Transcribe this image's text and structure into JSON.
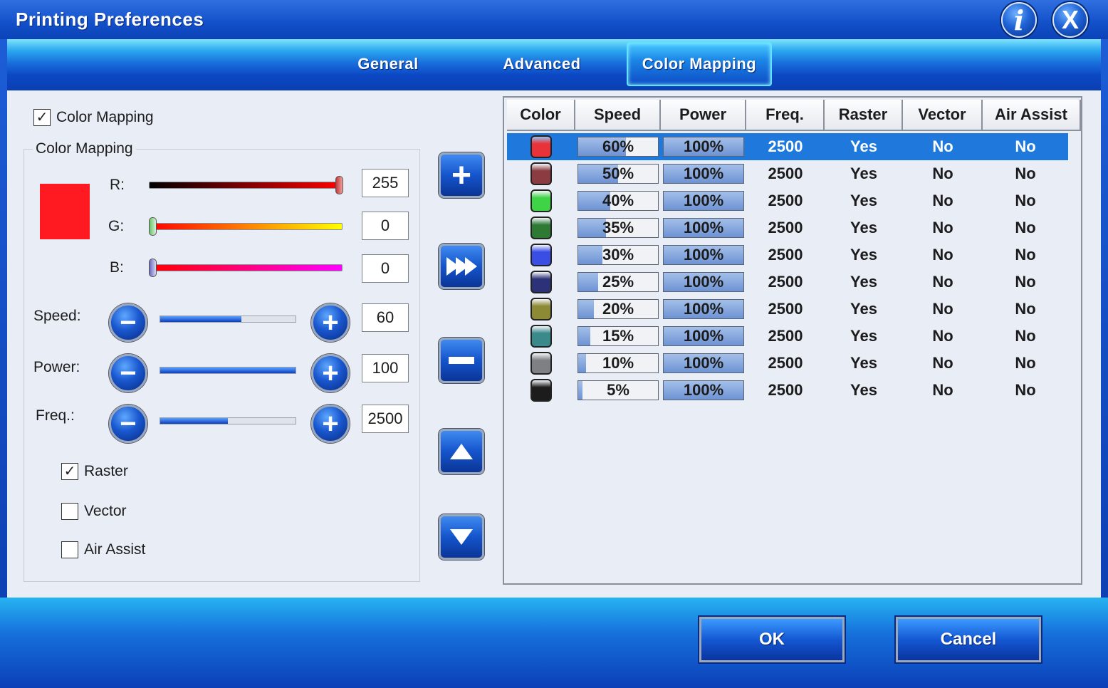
{
  "window": {
    "title": "Printing Preferences"
  },
  "title_buttons": {
    "info": "i",
    "close": "X"
  },
  "tabs": [
    {
      "label": "General"
    },
    {
      "label": "Advanced"
    },
    {
      "label": "Color Mapping",
      "active": true
    }
  ],
  "left": {
    "enable_checkbox": {
      "label": "Color Mapping",
      "checked": true
    },
    "group_title": "Color Mapping",
    "current_color": "#ff1a22",
    "rgb": {
      "r_label": "R:",
      "r_value": "255",
      "g_label": "G:",
      "g_value": "0",
      "b_label": "B:",
      "b_value": "0"
    },
    "speed": {
      "label": "Speed:",
      "value": "60",
      "fraction": 0.6
    },
    "power": {
      "label": "Power:",
      "value": "100",
      "fraction": 1.0
    },
    "freq": {
      "label": "Freq.:",
      "value": "2500",
      "fraction": 0.5
    },
    "checkboxes": [
      {
        "label": "Raster",
        "checked": true
      },
      {
        "label": "Vector",
        "checked": false
      },
      {
        "label": "Air Assist",
        "checked": false
      }
    ]
  },
  "table": {
    "headers": [
      "Color",
      "Speed",
      "Power",
      "Freq.",
      "Raster",
      "Vector",
      "Air Assist"
    ],
    "rows": [
      {
        "color": "#e8333a",
        "speed": "60%",
        "power": "100%",
        "freq": "2500",
        "raster": "Yes",
        "vector": "No",
        "air": "No",
        "selected": true
      },
      {
        "color": "#8c3c40",
        "speed": "50%",
        "power": "100%",
        "freq": "2500",
        "raster": "Yes",
        "vector": "No",
        "air": "No"
      },
      {
        "color": "#3fd446",
        "speed": "40%",
        "power": "100%",
        "freq": "2500",
        "raster": "Yes",
        "vector": "No",
        "air": "No"
      },
      {
        "color": "#2e7a35",
        "speed": "35%",
        "power": "100%",
        "freq": "2500",
        "raster": "Yes",
        "vector": "No",
        "air": "No"
      },
      {
        "color": "#3a4ee6",
        "speed": "30%",
        "power": "100%",
        "freq": "2500",
        "raster": "Yes",
        "vector": "No",
        "air": "No"
      },
      {
        "color": "#2d3278",
        "speed": "25%",
        "power": "100%",
        "freq": "2500",
        "raster": "Yes",
        "vector": "No",
        "air": "No"
      },
      {
        "color": "#8c8a35",
        "speed": "20%",
        "power": "100%",
        "freq": "2500",
        "raster": "Yes",
        "vector": "No",
        "air": "No"
      },
      {
        "color": "#3a8a8c",
        "speed": "15%",
        "power": "100%",
        "freq": "2500",
        "raster": "Yes",
        "vector": "No",
        "air": "No"
      },
      {
        "color": "#7e8084",
        "speed": "10%",
        "power": "100%",
        "freq": "2500",
        "raster": "Yes",
        "vector": "No",
        "air": "No"
      },
      {
        "color": "#1c1c1c",
        "speed": "5%",
        "power": "100%",
        "freq": "2500",
        "raster": "Yes",
        "vector": "No",
        "air": "No"
      }
    ]
  },
  "footer": {
    "ok_label": "OK",
    "cancel_label": "Cancel"
  }
}
